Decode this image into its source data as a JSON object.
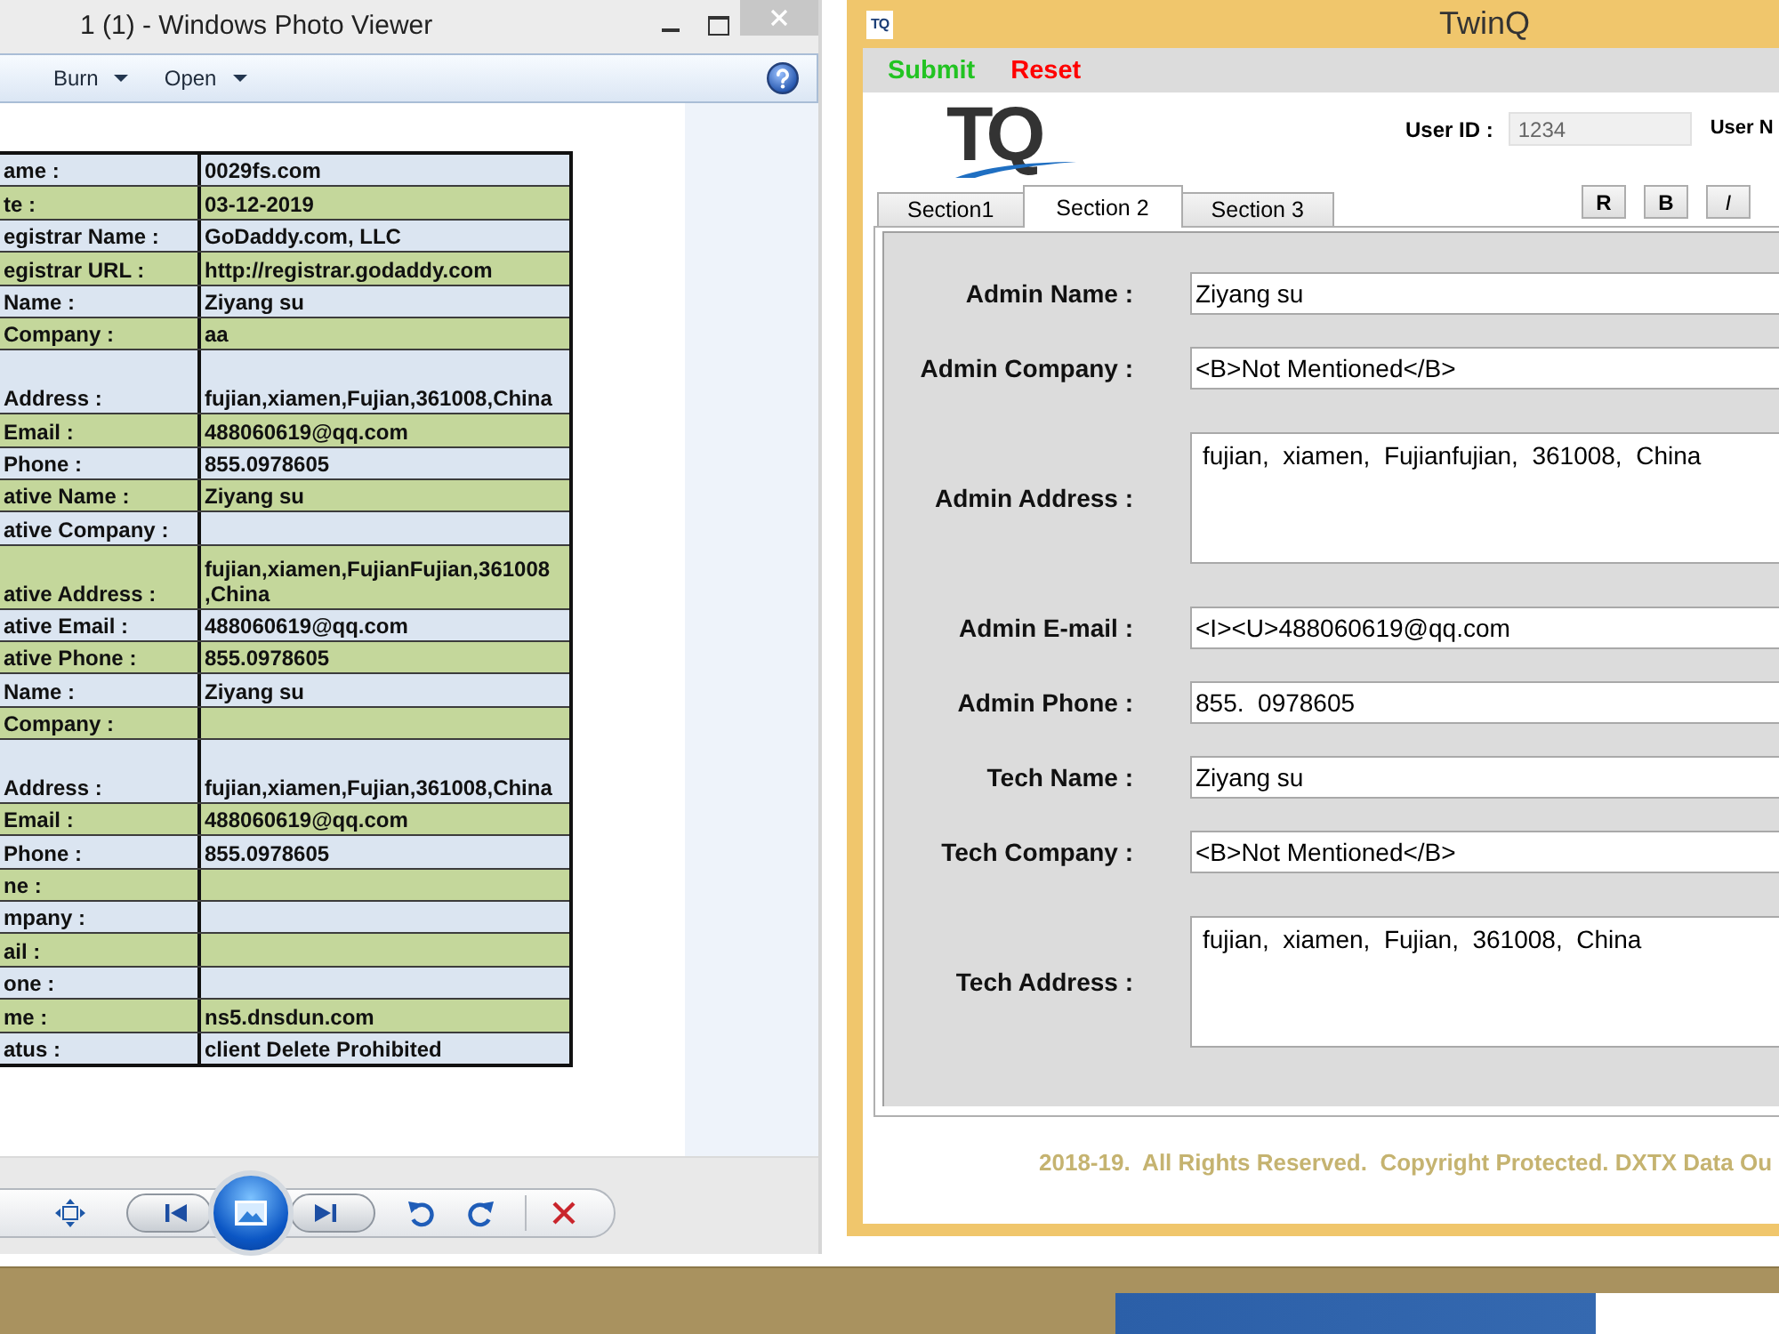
{
  "photo_viewer": {
    "title": "1 (1) - Windows Photo Viewer",
    "toolbar": [
      {
        "label": "Burn"
      },
      {
        "label": "Open"
      }
    ],
    "document_table": {
      "rows": [
        {
          "kind": "line",
          "label": "ame :",
          "value": "0029fs.com"
        },
        {
          "kind": "line",
          "label": "te :",
          "value": "03-12-2019"
        },
        {
          "kind": "line",
          "label": "egistrar Name :",
          "value": "GoDaddy.com, LLC"
        },
        {
          "kind": "line",
          "label": "egistrar URL :",
          "value": "http://registrar.godaddy.com"
        },
        {
          "kind": "line",
          "label": "Name :",
          "value": "Ziyang su"
        },
        {
          "kind": "line",
          "label": "Company :",
          "value": "aa"
        },
        {
          "kind": "tall",
          "label": "Address :",
          "value": "fujian,xiamen,Fujian,361008,China"
        },
        {
          "kind": "line",
          "label": "Email :",
          "value": "488060619@qq.com"
        },
        {
          "kind": "line",
          "label": "Phone :",
          "value": "855.0978605"
        },
        {
          "kind": "line",
          "label": "ative Name :",
          "value": "Ziyang su"
        },
        {
          "kind": "line",
          "label": "ative Company :"
        },
        {
          "kind": "tall",
          "label": "ative Address :",
          "value": "fujian,xiamen,FujianFujian,361008\n,China"
        },
        {
          "kind": "line",
          "label": "ative Email :",
          "value": "488060619@qq.com"
        },
        {
          "kind": "line",
          "label": "ative Phone :",
          "value": "855.0978605"
        },
        {
          "kind": "line",
          "label": "Name :",
          "value": "Ziyang su"
        },
        {
          "kind": "line",
          "label": "Company :"
        },
        {
          "kind": "tall",
          "label": "Address :",
          "value": "fujian,xiamen,Fujian,361008,China"
        },
        {
          "kind": "line",
          "label": "Email :",
          "value": "488060619@qq.com"
        },
        {
          "kind": "line",
          "label": "Phone :",
          "value": "855.0978605"
        },
        {
          "kind": "line",
          "label": "ne :"
        },
        {
          "kind": "line",
          "label": "mpany :"
        },
        {
          "kind": "line",
          "label": "ail :"
        },
        {
          "kind": "line",
          "label": "one :"
        },
        {
          "kind": "line",
          "label": "me :",
          "value": "ns5.dnsdun.com"
        },
        {
          "kind": "line",
          "label": "atus :",
          "value": "client Delete Prohibited"
        }
      ]
    }
  },
  "twinq": {
    "app_icon": "TQ",
    "title": "TwinQ",
    "menu": [
      {
        "label": "Submit",
        "color": "#22c322"
      },
      {
        "label": "Reset",
        "color": "#ff0000"
      }
    ],
    "logo": "TQ",
    "user_id": {
      "label": "User ID :",
      "value": "1234",
      "disabled": true
    },
    "user_name_label": "User N",
    "tabs": [
      {
        "label": "Section1",
        "selected": false
      },
      {
        "label": "Section 2",
        "selected": true
      },
      {
        "label": "Section 3",
        "selected": false
      }
    ],
    "format_buttons": [
      {
        "label": "R",
        "kind": "upright"
      },
      {
        "label": "B",
        "kind": "upright"
      },
      {
        "label": "I",
        "kind": "italic"
      }
    ],
    "fields": [
      {
        "kind": "line",
        "label": "Admin Name :",
        "value": "Ziyang su"
      },
      {
        "kind": "line",
        "label": "Admin Company :",
        "value": "<B>Not Mentioned</B>"
      },
      {
        "kind": "area",
        "label": "Admin Address :",
        "value": "fujian,  xiamen,  Fujianfujian,  361008,  China"
      },
      {
        "kind": "line",
        "label": "Admin E-mail :",
        "value": "<I><U>488060619@qq.com"
      },
      {
        "kind": "line",
        "label": "Admin Phone :",
        "value": "855.  0978605"
      },
      {
        "kind": "line",
        "label": "Tech Name :",
        "value": "Ziyang su"
      },
      {
        "kind": "line",
        "label": "Tech Company :",
        "value": "<B>Not Mentioned</B>"
      },
      {
        "kind": "area",
        "label": "Tech Address :",
        "value": "fujian,  xiamen,  Fujian,  361008,  China"
      }
    ],
    "footer": "2018-19.  All Rights Reserved.  Copyright Protected. DXTX Data Ou"
  }
}
